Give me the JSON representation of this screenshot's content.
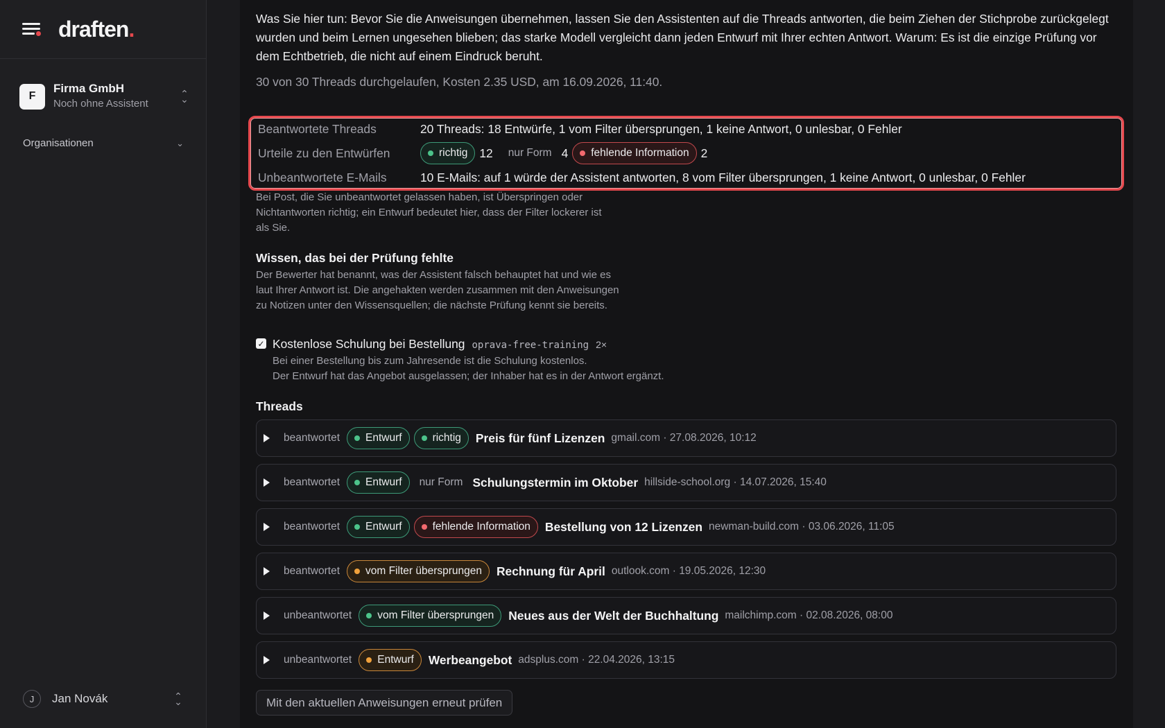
{
  "app": {
    "logo": "draften",
    "logo_dot": "."
  },
  "sidebar": {
    "org": {
      "initial": "F",
      "name": "Firma GmbH",
      "subtitle": "Noch ohne Assistent"
    },
    "organisations_label": "Organisationen",
    "user": {
      "initial": "J",
      "name": "Jan Novák"
    }
  },
  "main": {
    "intro": "Was Sie hier tun: Bevor Sie die Anweisungen übernehmen, lassen Sie den Assistenten auf die Threads antworten, die beim Ziehen der Stichprobe zurückgelegt wurden und beim Lernen ungesehen blieben; das starke Modell vergleicht dann jeden Entwurf mit Ihrer echten Antwort. Warum: Es ist die einzige Prüfung vor dem Echtbetrieb, die nicht auf einem Eindruck beruht.",
    "run_meta": "30 von 30 Threads durchgelaufen, Kosten 2.35 USD, am 16.09.2026, 11:40.",
    "summary": {
      "answered_label": "Beantwortete Threads",
      "answered_value": "20 Threads: 18 Entwürfe, 1 vom Filter übersprungen, 1 keine Antwort, 0 unlesbar, 0 Fehler",
      "verdicts_label": "Urteile zu den Entwürfen",
      "verdict_correct": "richtig",
      "verdict_correct_count": "12",
      "verdict_form": "nur Form",
      "verdict_form_count": "4",
      "verdict_missing": "fehlende Information",
      "verdict_missing_count": "2",
      "unanswered_label": "Unbeantwortete E-Mails",
      "unanswered_value": "10 E-Mails: auf 1 würde der Assistent antworten, 8 vom Filter übersprungen, 1 keine Antwort, 0 unlesbar, 0 Fehler"
    },
    "note": "Bei Post, die Sie unbeantwortet gelassen haben, ist Überspringen oder Nichtantworten richtig; ein Entwurf bedeutet hier, dass der Filter lockerer ist als Sie.",
    "knowledge": {
      "title": "Wissen, das bei der Prüfung fehlte",
      "description": "Der Bewerter hat benannt, was der Assistent falsch behauptet hat und wie es laut Ihrer Antwort ist. Die angehakten werden zusammen mit den Anweisungen zu Notizen unter den Wissensquellen; die nächste Prüfung kennt sie bereits.",
      "item": {
        "checked": true,
        "title": "Kostenlose Schulung bei Bestellung",
        "code": "oprava-free-training",
        "count": "2×",
        "line1": "Bei einer Bestellung bis zum Jahresende ist die Schulung kostenlos.",
        "line2": "Der Entwurf hat das Angebot ausgelassen; der Inhaber hat es in der Antwort ergänzt."
      }
    },
    "threads_title": "Threads",
    "threads": [
      {
        "status": "beantwortet",
        "badge1": "Entwurf",
        "badge2": "richtig",
        "subject": "Preis für fünf Lizenzen",
        "meta": "gmail.com · 27.08.2026, 10:12"
      },
      {
        "status": "beantwortet",
        "badge1": "Entwurf",
        "badge2": "nur Form",
        "subject": "Schulungstermin im Oktober",
        "meta": "hillside-school.org · 14.07.2026, 15:40"
      },
      {
        "status": "beantwortet",
        "badge1": "Entwurf",
        "badge2": "fehlende Information",
        "subject": "Bestellung von 12 Lizenzen",
        "meta": "newman-build.com · 03.06.2026, 11:05"
      },
      {
        "status": "beantwortet",
        "badge1": "vom Filter übersprungen",
        "subject": "Rechnung für April",
        "meta": "outlook.com · 19.05.2026, 12:30"
      },
      {
        "status": "unbeantwortet",
        "badge1": "vom Filter übersprungen",
        "subject": "Neues aus der Welt der Buchhaltung",
        "meta": "mailchimp.com · 02.08.2026, 08:00"
      },
      {
        "status": "unbeantwortet",
        "badge1": "Entwurf",
        "subject": "Werbeangebot",
        "meta": "adsplus.com · 22.04.2026, 13:15"
      }
    ],
    "rerun_label": "Mit den aktuellen Anweisungen erneut prüfen"
  },
  "colors": {
    "accent_red": "#e5484d",
    "green": "#4cc38a",
    "amber": "#f0a13c",
    "red": "#f2696e"
  }
}
